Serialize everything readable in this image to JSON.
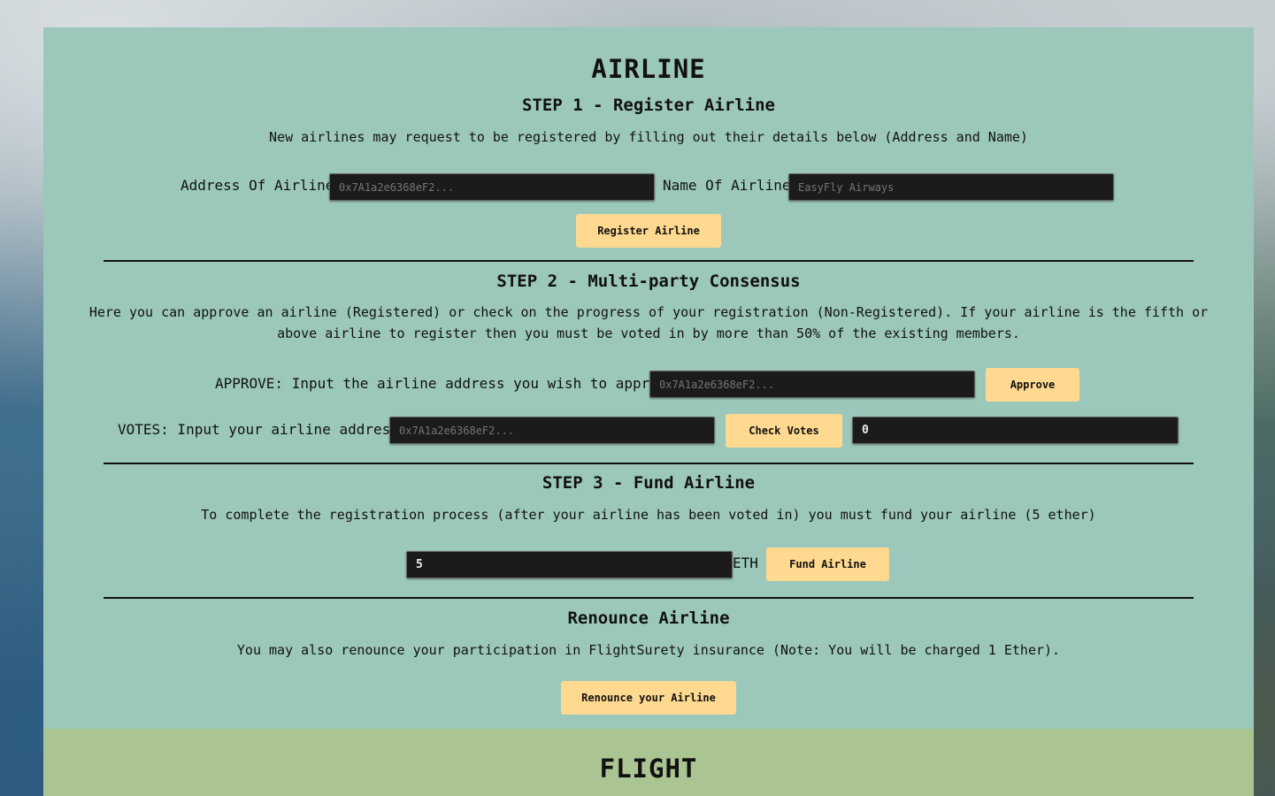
{
  "airline": {
    "title": "AIRLINE",
    "step1": {
      "heading": "STEP 1 - Register Airline",
      "description": "New airlines may request to be registered by filling out their details below (Address and Name)",
      "address_label": "Address Of Airline",
      "address_placeholder": "0x7A1a2e6368eF2...",
      "name_label": "Name Of Airline",
      "name_placeholder": "EasyFly Airways",
      "register_button": "Register Airline"
    },
    "step2": {
      "heading": "STEP 2 - Multi-party Consensus",
      "description_line1": "Here you can approve an airline (Registered) or check on the progress of your registration (Non-Registered). If your airline is the fifth or",
      "description_line2": "above airline to register then you must be voted in by more than 50% of the existing members.",
      "approve_label": "APPROVE: Input the airline address you wish to approve:",
      "approve_placeholder": "0x7A1a2e6368eF2...",
      "approve_button": "Approve",
      "votes_label": "VOTES: Input your airline address:",
      "votes_placeholder": "0x7A1a2e6368eF2...",
      "check_votes_button": "Check Votes",
      "votes_result": "0"
    },
    "step3": {
      "heading": "STEP 3 - Fund Airline",
      "description": "To complete the registration process (after your airline has been voted in) you must fund your airline (5 ether)",
      "fund_value": "5",
      "unit": "ETH",
      "fund_button": "Fund Airline"
    },
    "renounce": {
      "heading": "Renounce Airline",
      "description": "You may also renounce your participation in FlightSurety insurance (Note: You will be charged 1 Ether).",
      "renounce_button": "Renounce your Airline"
    }
  },
  "flight": {
    "title": "FLIGHT"
  },
  "colors": {
    "airline_panel": "#9cc8bb",
    "flight_panel": "#abc592",
    "button": "#fed98f",
    "input": "#1b1b1b"
  }
}
